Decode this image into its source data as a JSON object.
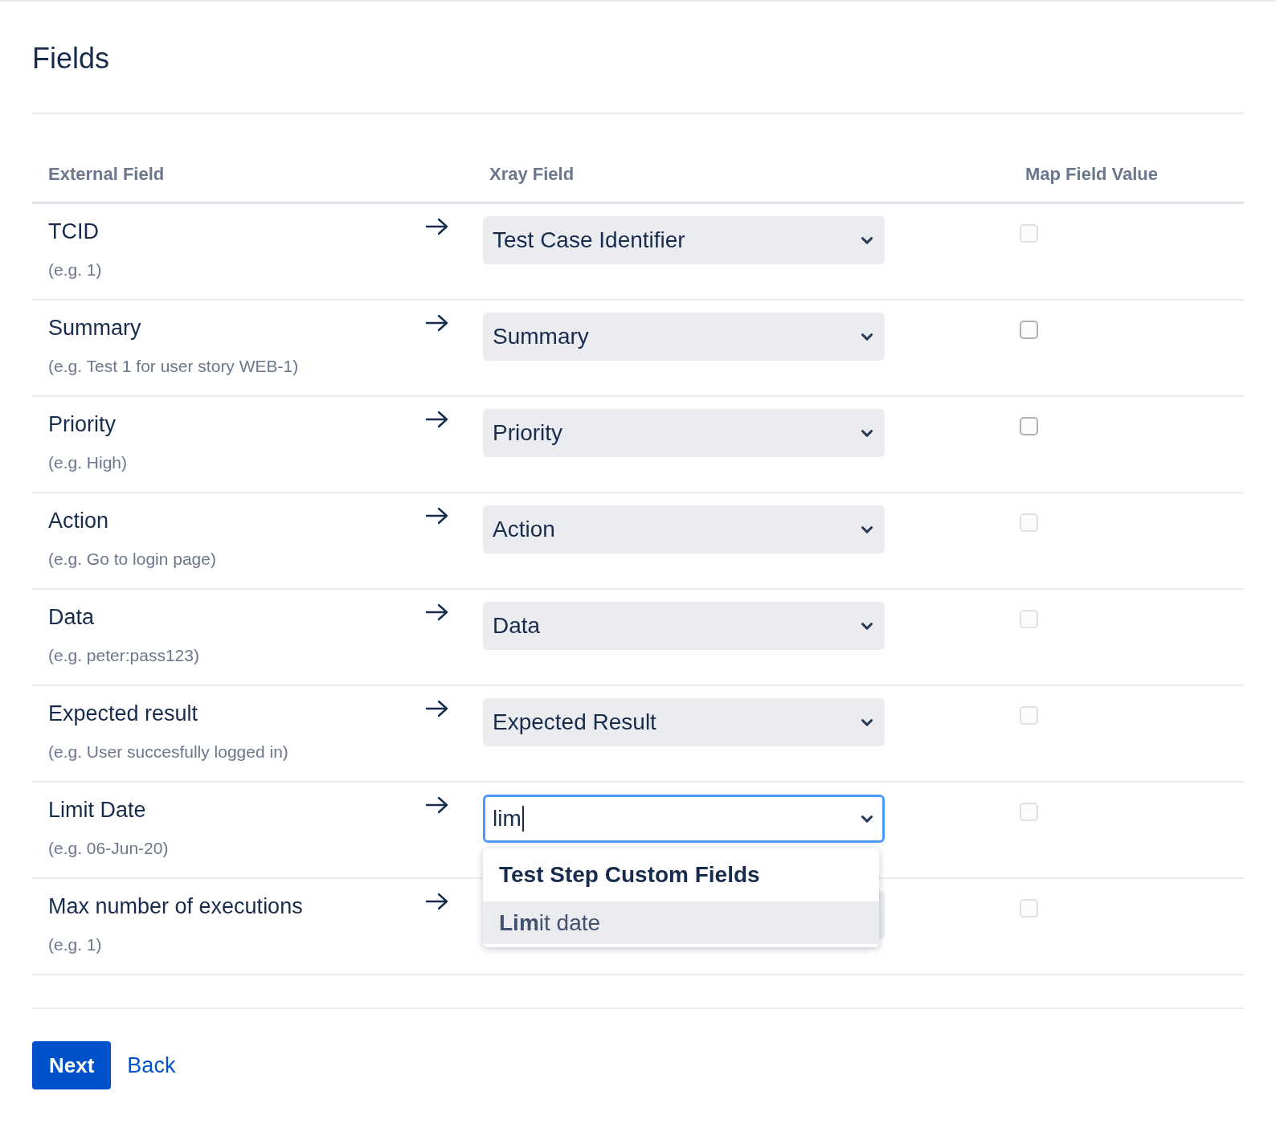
{
  "title": "Fields",
  "columns": [
    "External Field",
    "Xray Field",
    "Map Field Value"
  ],
  "rows": [
    {
      "name": "TCID",
      "example": "(e.g. 1)",
      "value": "Test Case Identifier",
      "map_value": false,
      "disabled": true
    },
    {
      "name": "Summary",
      "example": "(e.g. Test 1 for user story WEB-1)",
      "value": "Summary",
      "map_value": false,
      "disabled": false
    },
    {
      "name": "Priority",
      "example": "(e.g. High)",
      "value": "Priority",
      "map_value": false,
      "disabled": false
    },
    {
      "name": "Action",
      "example": "(e.g. Go to login page)",
      "value": "Action",
      "map_value": false,
      "disabled": true
    },
    {
      "name": "Data",
      "example": "(e.g. peter:pass123)",
      "value": "Data",
      "map_value": false,
      "disabled": true
    },
    {
      "name": "Expected result",
      "example": "(e.g. User succesfully logged in)",
      "value": "Expected Result",
      "map_value": false,
      "disabled": true
    },
    {
      "name": "Limit Date",
      "example": "(e.g. 06-Jun-20)",
      "typed": "lim",
      "focused": true,
      "map_value": false,
      "disabled": true,
      "menu": {
        "group": "Test Step Custom Fields",
        "options": [
          {
            "label": "**Lim**it date",
            "selected": true
          }
        ]
      }
    },
    {
      "name": "Max number of executions",
      "example": "(e.g. 1)",
      "map_value": false,
      "disabled": true
    }
  ],
  "buttons": {
    "primary": "Next",
    "link": "Back"
  }
}
